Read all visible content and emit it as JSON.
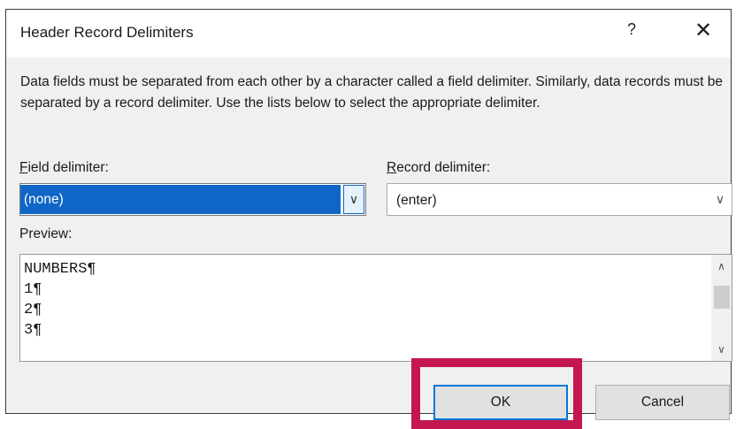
{
  "dialog": {
    "title": "Header Record Delimiters",
    "help_label": "?",
    "close_label": "✕",
    "description": "Data fields must be separated from each other by a character called a field delimiter. Similarly, data records must be separated by a record delimiter.  Use the lists below to select the appropriate delimiter."
  },
  "field_delimiter": {
    "label_accel": "F",
    "label_rest": "ield delimiter:",
    "value": "(none)"
  },
  "record_delimiter": {
    "label_accel": "R",
    "label_rest": "ecord delimiter:",
    "value": "(enter)"
  },
  "preview": {
    "label": "Preview:",
    "lines": [
      "NUMBERS¶",
      "1¶",
      "2¶",
      "3¶"
    ]
  },
  "buttons": {
    "ok": "OK",
    "cancel": "Cancel"
  },
  "colors": {
    "selection": "#0f66c7",
    "highlight_box": "#c4174f",
    "focus_border": "#0078d7"
  }
}
